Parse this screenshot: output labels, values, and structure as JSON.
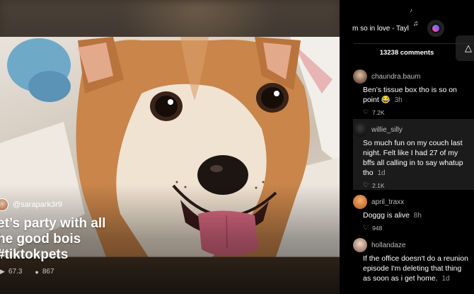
{
  "video": {
    "author": "@sarapark3r9",
    "caption": "et’s party with all\nhe good bois\n#tiktokpets",
    "play_count": "67.3",
    "comment_count": "867"
  },
  "music": {
    "track": "m so in love - Tayl"
  },
  "comments_header": "13238 comments",
  "comments": [
    {
      "user": "chaundra.baum",
      "text": "Ben’s tissue box tho is so on point 😂",
      "time": "3h",
      "likes": "7.2K"
    },
    {
      "user": "willie_silly",
      "text": "So much fun on my couch last night. Felt like I had 27 of my bffs all calling in to say whatup tho",
      "time": "1d",
      "likes": "2.1K"
    },
    {
      "user": "april_traxx",
      "text": "Doggg is alive",
      "time": "8h",
      "likes": "948"
    },
    {
      "user": "hollandaze",
      "text": "If the office doesn't do a reunion episode I'm deleting that thing as soon as i get home.",
      "time": "1d",
      "likes": ""
    }
  ],
  "icons": {
    "music": "music-note-icon",
    "side_button": "bell-icon",
    "play": "play-icon",
    "comment": "comment-icon",
    "heart": "heart-icon"
  },
  "colors": {
    "background": "#000000",
    "highlight": "#1b1b1b"
  }
}
